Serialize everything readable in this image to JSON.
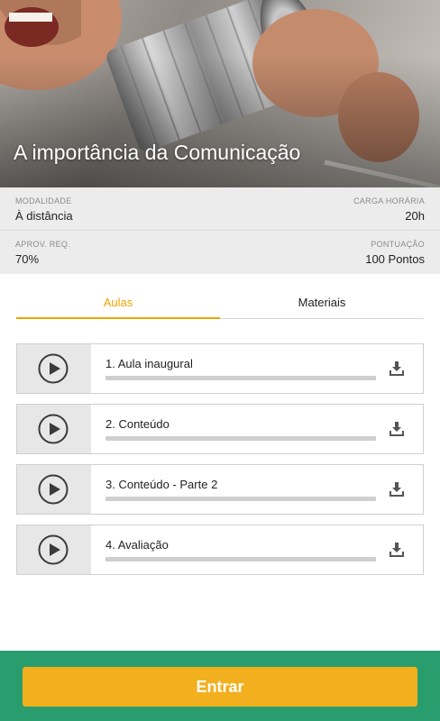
{
  "hero": {
    "title": "A importância da Comunicação"
  },
  "info": {
    "modalidade": {
      "label": "MODALIDADE",
      "value": "À distância"
    },
    "carga_horaria": {
      "label": "CARGA HORÁRIA",
      "value": "20h"
    },
    "aprov_req": {
      "label": "APROV. REQ.",
      "value": "70%"
    },
    "pontuacao": {
      "label": "PONTUAÇÃO",
      "value": "100 Pontos"
    }
  },
  "tabs": [
    {
      "label": "Aulas",
      "active": true
    },
    {
      "label": "Materiais",
      "active": false
    }
  ],
  "lessons": [
    {
      "title": "1. Aula inaugural",
      "progress": 0,
      "icon": "play-icon",
      "action_icon": "download-icon"
    },
    {
      "title": "2. Conteúdo",
      "progress": 0,
      "icon": "play-icon",
      "action_icon": "download-icon"
    },
    {
      "title": "3. Conteúdo - Parte 2",
      "progress": 0,
      "icon": "play-icon",
      "action_icon": "download-icon"
    },
    {
      "title": "4. Avaliação",
      "progress": 0,
      "icon": "play-icon",
      "action_icon": "download-icon"
    }
  ],
  "footer": {
    "enter_label": "Entrar"
  },
  "colors": {
    "accent": "#f0a500",
    "button": "#f2b01e",
    "footer_bg": "#2a9d6e",
    "info_bg": "#ececec"
  }
}
